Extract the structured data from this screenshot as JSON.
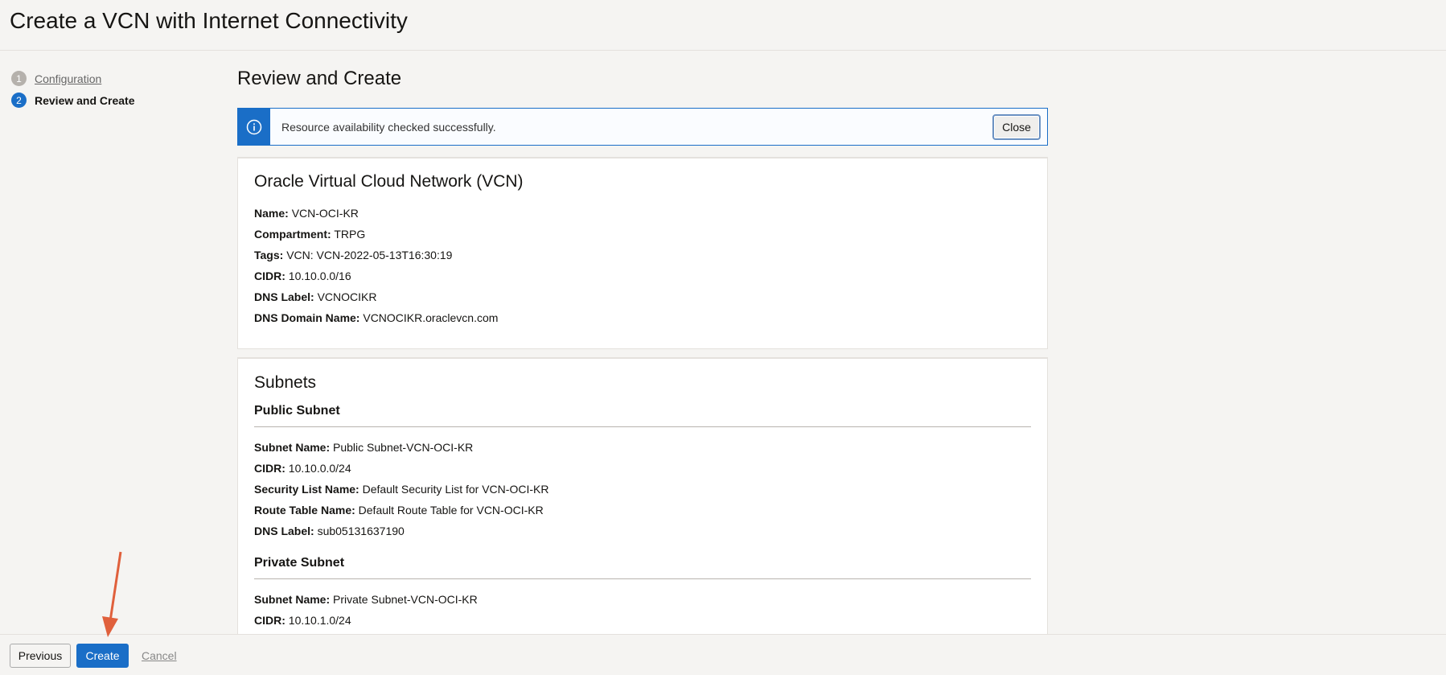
{
  "header": {
    "title": "Create a VCN with Internet Connectivity"
  },
  "steps": [
    {
      "number": "1",
      "label": "Configuration"
    },
    {
      "number": "2",
      "label": "Review and Create"
    }
  ],
  "main": {
    "title": "Review and Create",
    "alert": {
      "message": "Resource availability checked successfully.",
      "close_label": "Close"
    },
    "vcn": {
      "title": "Oracle Virtual Cloud Network (VCN)",
      "fields": [
        {
          "label": "Name:",
          "value": "VCN-OCI-KR"
        },
        {
          "label": "Compartment:",
          "value": "TRPG"
        },
        {
          "label": "Tags:",
          "value": "VCN: VCN-2022-05-13T16:30:19"
        },
        {
          "label": "CIDR:",
          "value": "10.10.0.0/16"
        },
        {
          "label": "DNS Label:",
          "value": "VCNOCIKR"
        },
        {
          "label": "DNS Domain Name:",
          "value": "VCNOCIKR.oraclevcn.com"
        }
      ]
    },
    "subnets": {
      "title": "Subnets",
      "public": {
        "title": "Public Subnet",
        "fields": [
          {
            "label": "Subnet Name:",
            "value": "Public Subnet-VCN-OCI-KR"
          },
          {
            "label": "CIDR:",
            "value": "10.10.0.0/24"
          },
          {
            "label": "Security List Name:",
            "value": "Default Security List for VCN-OCI-KR"
          },
          {
            "label": "Route Table Name:",
            "value": "Default Route Table for VCN-OCI-KR"
          },
          {
            "label": "DNS Label:",
            "value": "sub05131637190"
          }
        ]
      },
      "private": {
        "title": "Private Subnet",
        "fields": [
          {
            "label": "Subnet Name:",
            "value": "Private Subnet-VCN-OCI-KR"
          },
          {
            "label": "CIDR:",
            "value": "10.10.1.0/24"
          }
        ]
      }
    }
  },
  "footer": {
    "previous_label": "Previous",
    "create_label": "Create",
    "cancel_label": "Cancel"
  },
  "colors": {
    "accent": "#1a6ec7",
    "annotation_arrow": "#e0603c"
  },
  "icons": [
    "info-icon",
    "annotation-arrow-icon"
  ]
}
